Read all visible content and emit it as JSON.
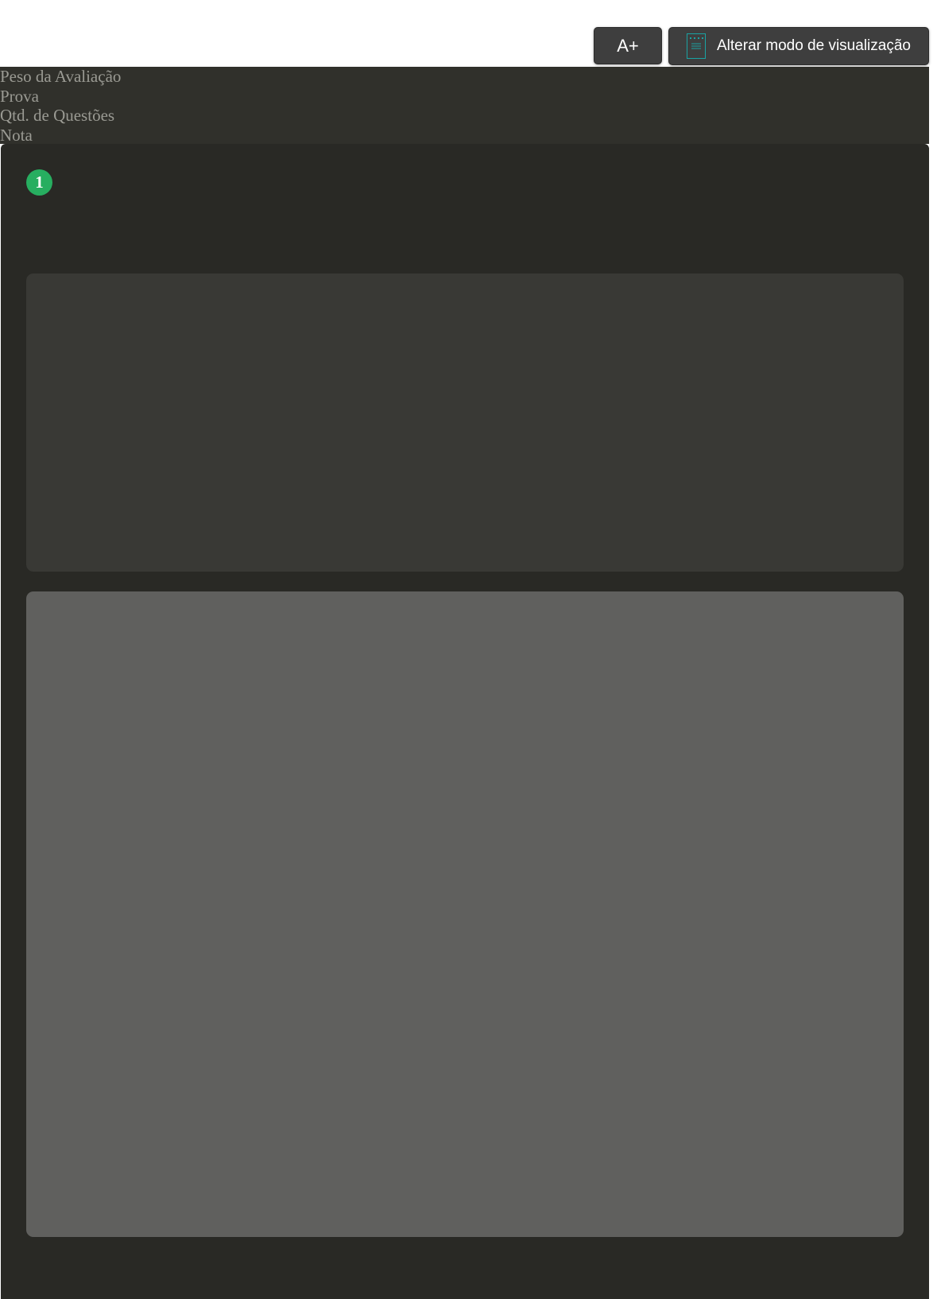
{
  "toolbar": {
    "font_increase_label": "A+",
    "view_mode_label": "Alterar modo de visualização",
    "view_mode_icon": "document-view-icon",
    "accent_color": "#1aa3a3"
  },
  "exam_info": {
    "weight_label": "Peso da Avaliação",
    "exam_label": "Prova",
    "question_count_label": "Qtd. de Questões",
    "grade_label": "Nota"
  },
  "question": {
    "number": "1",
    "badge_color": "#27ae60"
  }
}
